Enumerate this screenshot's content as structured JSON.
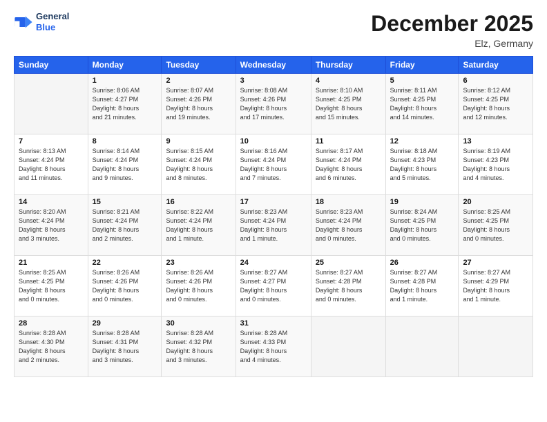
{
  "logo": {
    "text_general": "General",
    "text_blue": "Blue"
  },
  "title": "December 2025",
  "location": "Elz, Germany",
  "days_header": [
    "Sunday",
    "Monday",
    "Tuesday",
    "Wednesday",
    "Thursday",
    "Friday",
    "Saturday"
  ],
  "weeks": [
    [
      {
        "day": "",
        "info": ""
      },
      {
        "day": "1",
        "info": "Sunrise: 8:06 AM\nSunset: 4:27 PM\nDaylight: 8 hours\nand 21 minutes."
      },
      {
        "day": "2",
        "info": "Sunrise: 8:07 AM\nSunset: 4:26 PM\nDaylight: 8 hours\nand 19 minutes."
      },
      {
        "day": "3",
        "info": "Sunrise: 8:08 AM\nSunset: 4:26 PM\nDaylight: 8 hours\nand 17 minutes."
      },
      {
        "day": "4",
        "info": "Sunrise: 8:10 AM\nSunset: 4:25 PM\nDaylight: 8 hours\nand 15 minutes."
      },
      {
        "day": "5",
        "info": "Sunrise: 8:11 AM\nSunset: 4:25 PM\nDaylight: 8 hours\nand 14 minutes."
      },
      {
        "day": "6",
        "info": "Sunrise: 8:12 AM\nSunset: 4:25 PM\nDaylight: 8 hours\nand 12 minutes."
      }
    ],
    [
      {
        "day": "7",
        "info": "Sunrise: 8:13 AM\nSunset: 4:24 PM\nDaylight: 8 hours\nand 11 minutes."
      },
      {
        "day": "8",
        "info": "Sunrise: 8:14 AM\nSunset: 4:24 PM\nDaylight: 8 hours\nand 9 minutes."
      },
      {
        "day": "9",
        "info": "Sunrise: 8:15 AM\nSunset: 4:24 PM\nDaylight: 8 hours\nand 8 minutes."
      },
      {
        "day": "10",
        "info": "Sunrise: 8:16 AM\nSunset: 4:24 PM\nDaylight: 8 hours\nand 7 minutes."
      },
      {
        "day": "11",
        "info": "Sunrise: 8:17 AM\nSunset: 4:24 PM\nDaylight: 8 hours\nand 6 minutes."
      },
      {
        "day": "12",
        "info": "Sunrise: 8:18 AM\nSunset: 4:23 PM\nDaylight: 8 hours\nand 5 minutes."
      },
      {
        "day": "13",
        "info": "Sunrise: 8:19 AM\nSunset: 4:23 PM\nDaylight: 8 hours\nand 4 minutes."
      }
    ],
    [
      {
        "day": "14",
        "info": "Sunrise: 8:20 AM\nSunset: 4:24 PM\nDaylight: 8 hours\nand 3 minutes."
      },
      {
        "day": "15",
        "info": "Sunrise: 8:21 AM\nSunset: 4:24 PM\nDaylight: 8 hours\nand 2 minutes."
      },
      {
        "day": "16",
        "info": "Sunrise: 8:22 AM\nSunset: 4:24 PM\nDaylight: 8 hours\nand 1 minute."
      },
      {
        "day": "17",
        "info": "Sunrise: 8:23 AM\nSunset: 4:24 PM\nDaylight: 8 hours\nand 1 minute."
      },
      {
        "day": "18",
        "info": "Sunrise: 8:23 AM\nSunset: 4:24 PM\nDaylight: 8 hours\nand 0 minutes."
      },
      {
        "day": "19",
        "info": "Sunrise: 8:24 AM\nSunset: 4:25 PM\nDaylight: 8 hours\nand 0 minutes."
      },
      {
        "day": "20",
        "info": "Sunrise: 8:25 AM\nSunset: 4:25 PM\nDaylight: 8 hours\nand 0 minutes."
      }
    ],
    [
      {
        "day": "21",
        "info": "Sunrise: 8:25 AM\nSunset: 4:25 PM\nDaylight: 8 hours\nand 0 minutes."
      },
      {
        "day": "22",
        "info": "Sunrise: 8:26 AM\nSunset: 4:26 PM\nDaylight: 8 hours\nand 0 minutes."
      },
      {
        "day": "23",
        "info": "Sunrise: 8:26 AM\nSunset: 4:26 PM\nDaylight: 8 hours\nand 0 minutes."
      },
      {
        "day": "24",
        "info": "Sunrise: 8:27 AM\nSunset: 4:27 PM\nDaylight: 8 hours\nand 0 minutes."
      },
      {
        "day": "25",
        "info": "Sunrise: 8:27 AM\nSunset: 4:28 PM\nDaylight: 8 hours\nand 0 minutes."
      },
      {
        "day": "26",
        "info": "Sunrise: 8:27 AM\nSunset: 4:28 PM\nDaylight: 8 hours\nand 1 minute."
      },
      {
        "day": "27",
        "info": "Sunrise: 8:27 AM\nSunset: 4:29 PM\nDaylight: 8 hours\nand 1 minute."
      }
    ],
    [
      {
        "day": "28",
        "info": "Sunrise: 8:28 AM\nSunset: 4:30 PM\nDaylight: 8 hours\nand 2 minutes."
      },
      {
        "day": "29",
        "info": "Sunrise: 8:28 AM\nSunset: 4:31 PM\nDaylight: 8 hours\nand 3 minutes."
      },
      {
        "day": "30",
        "info": "Sunrise: 8:28 AM\nSunset: 4:32 PM\nDaylight: 8 hours\nand 3 minutes."
      },
      {
        "day": "31",
        "info": "Sunrise: 8:28 AM\nSunset: 4:33 PM\nDaylight: 8 hours\nand 4 minutes."
      },
      {
        "day": "",
        "info": ""
      },
      {
        "day": "",
        "info": ""
      },
      {
        "day": "",
        "info": ""
      }
    ]
  ]
}
